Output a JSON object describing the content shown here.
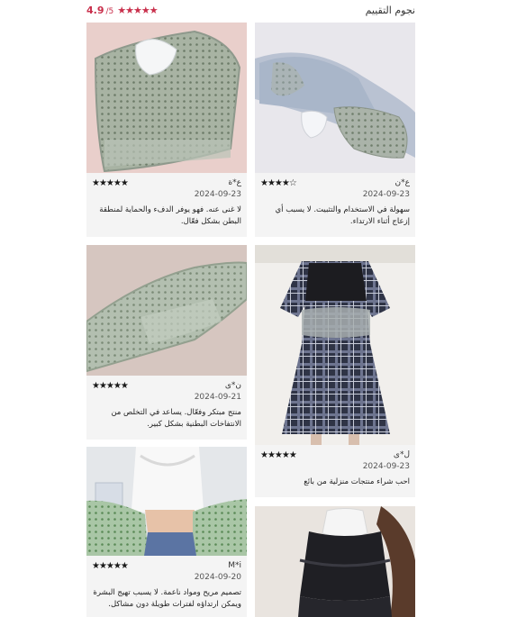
{
  "header": {
    "title": "نجوم التقييم",
    "rating": "4.9",
    "rating_max": "/5",
    "stars": "★★★★★"
  },
  "colors": {
    "accent": "#c9304c",
    "card_bg": "#f4f4f4"
  },
  "reviews": [
    {
      "author": "ع*ن",
      "stars": "★★★★☆",
      "rating": 4,
      "date": "2024-09-23",
      "text": "سهولة في الاستخدام والتثبيت. لا يسبب أي إزعاج أثناء الارتداء."
    },
    {
      "author": "ع*ة",
      "stars": "★★★★★",
      "rating": 5,
      "date": "2024-09-23",
      "text": "لا غنى عنه. فهو يوفر الدفء والحماية لمنطقة البطن بشكل فعّال."
    },
    {
      "author": "ن*ى",
      "stars": "★★★★★",
      "rating": 5,
      "date": "2024-09-21",
      "text": "منتج مبتكر وفعّال. يساعد في التخلص من الانتفاخات البطنية بشكل كبير."
    },
    {
      "author": "ل*ى",
      "stars": "★★★★★",
      "rating": 5,
      "date": "2024-09-23",
      "text": "احب شراء منتجات منزلية من بائع"
    },
    {
      "author": "M*i",
      "stars": "★★★★★",
      "rating": 5,
      "date": "2024-09-20",
      "text": "تصميم مريح ومواد ناعمة. لا يسبب تهيج البشرة ويمكن ارتداؤه لفترات طويلة دون مشاكل."
    }
  ]
}
